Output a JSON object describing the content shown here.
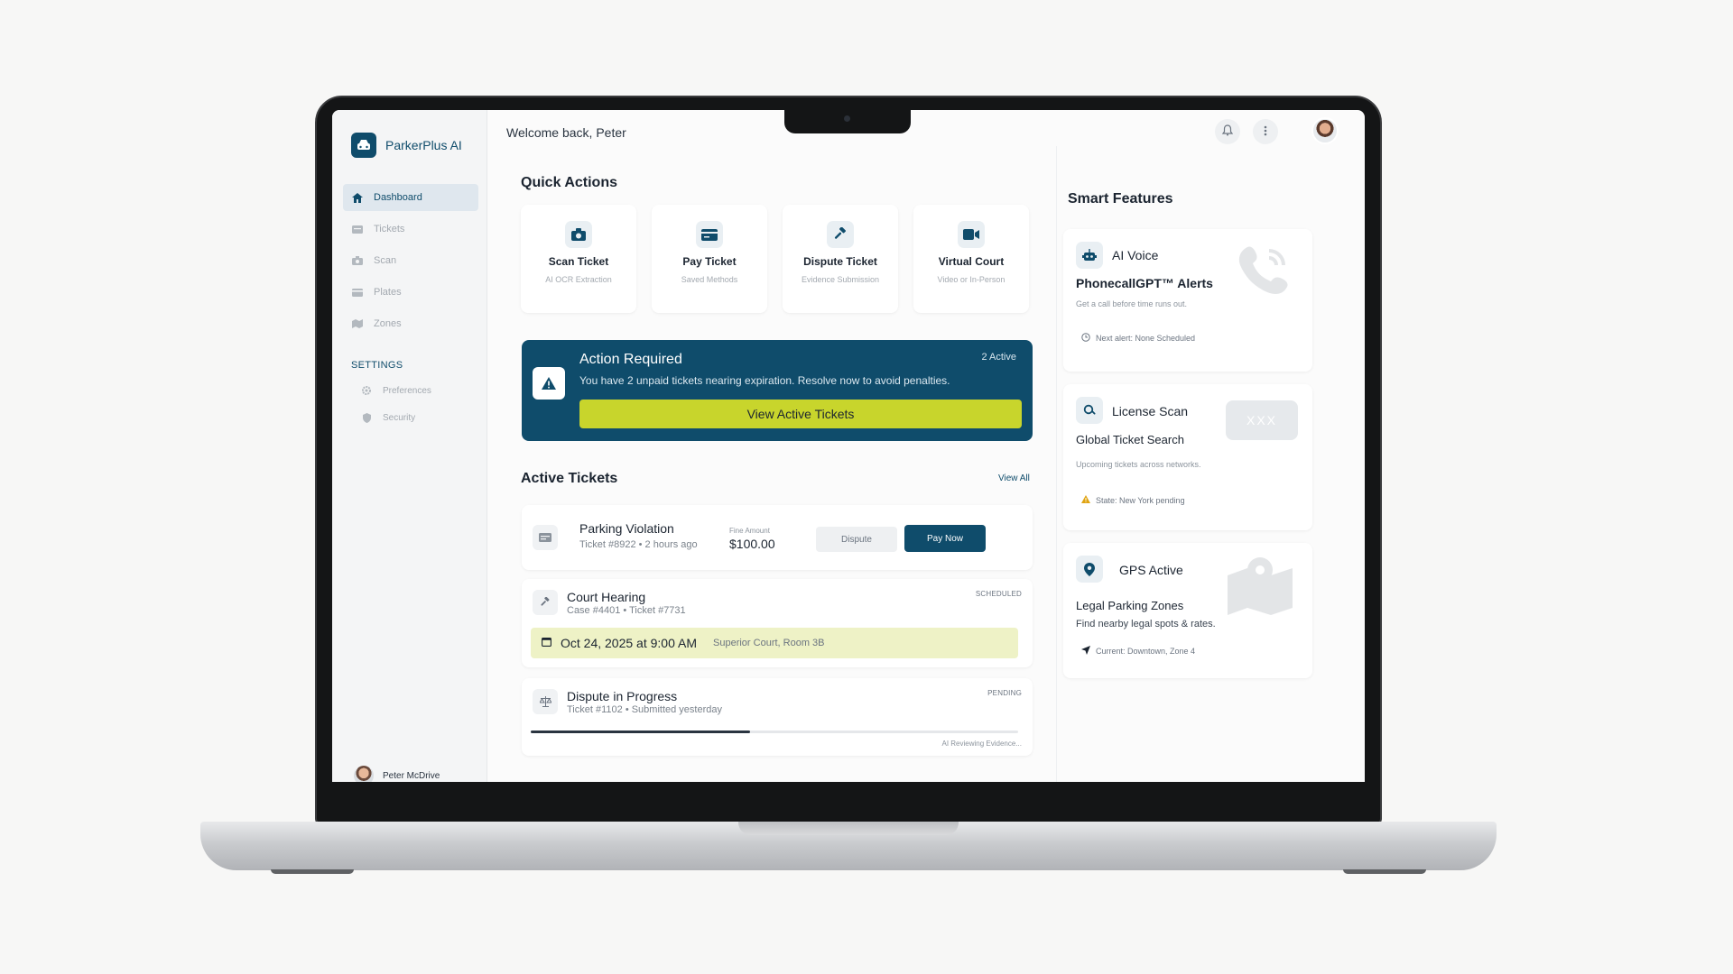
{
  "brand": {
    "name": "ParkerPlus AI"
  },
  "sidebar": {
    "items": [
      {
        "label": "Dashboard",
        "icon": "home-icon",
        "active": true
      },
      {
        "label": "Tickets",
        "icon": "ticket-icon"
      },
      {
        "label": "Scan",
        "icon": "camera-icon"
      },
      {
        "label": "Plates",
        "icon": "card-icon"
      },
      {
        "label": "Zones",
        "icon": "map-icon"
      }
    ],
    "settings_label": "SETTINGS",
    "settings_items": [
      {
        "label": "Preferences",
        "icon": "gear-icon"
      },
      {
        "label": "Security",
        "icon": "shield-icon"
      }
    ],
    "profile_name": "Peter McDrive"
  },
  "header": {
    "welcome": "Welcome back, Peter"
  },
  "quick_actions": {
    "title": "Quick Actions",
    "items": [
      {
        "title": "Scan Ticket",
        "subtitle": "AI OCR Extraction",
        "icon": "camera-icon"
      },
      {
        "title": "Pay Ticket",
        "subtitle": "Saved Methods",
        "icon": "credit-card-icon"
      },
      {
        "title": "Dispute Ticket",
        "subtitle": "Evidence Submission",
        "icon": "gavel-icon"
      },
      {
        "title": "Virtual Court",
        "subtitle": "Video or In-Person",
        "icon": "video-icon"
      }
    ]
  },
  "alert": {
    "title": "Action Required",
    "badge": "2 Active",
    "text": "You have 2 unpaid tickets nearing expiration.  Resolve now to avoid penalties.",
    "button": "View Active Tickets"
  },
  "active_tickets": {
    "title": "Active Tickets",
    "view_all": "View All",
    "parking": {
      "title": "Parking Violation",
      "subtitle": "Ticket #8922 • 2 hours ago",
      "fine_label": "Fine Amount",
      "amount": "$100.00",
      "dispute": "Dispute",
      "pay": "Pay Now"
    },
    "court": {
      "title": "Court Hearing",
      "subtitle": "Case #4401 • Ticket #7731",
      "status": "SCHEDULED",
      "date": "Oct 24, 2025 at 9:00 AM",
      "location": "Superior Court, Room 3B"
    },
    "dispute": {
      "title": "Dispute in Progress",
      "subtitle": "Ticket #1102 • Submitted yesterday",
      "status": "PENDING",
      "progress": 0.45,
      "progress_text": "AI Reviewing Evidence..."
    }
  },
  "smart_features": {
    "title": "Smart Features",
    "voice": {
      "label": "AI Voice",
      "title": "PhonecallGPT™ Alerts",
      "subtitle": "Get a call before time runs out.",
      "note": "Next alert: None Scheduled"
    },
    "license": {
      "label": "License Scan",
      "title": "Global Ticket Search",
      "subtitle": "Upcoming tickets across networks.",
      "note": "State: New York pending",
      "plate_glyph": "XXX"
    },
    "gps": {
      "label": "GPS Active",
      "title": "Legal Parking Zones",
      "subtitle": "Find nearby legal spots & rates.",
      "note": "Current: Downtown, Zone 4"
    }
  },
  "colors": {
    "primary": "#0f4c6b",
    "accent": "#c8d52c",
    "highlight": "#eef2c6",
    "warning": "#e0a412"
  }
}
